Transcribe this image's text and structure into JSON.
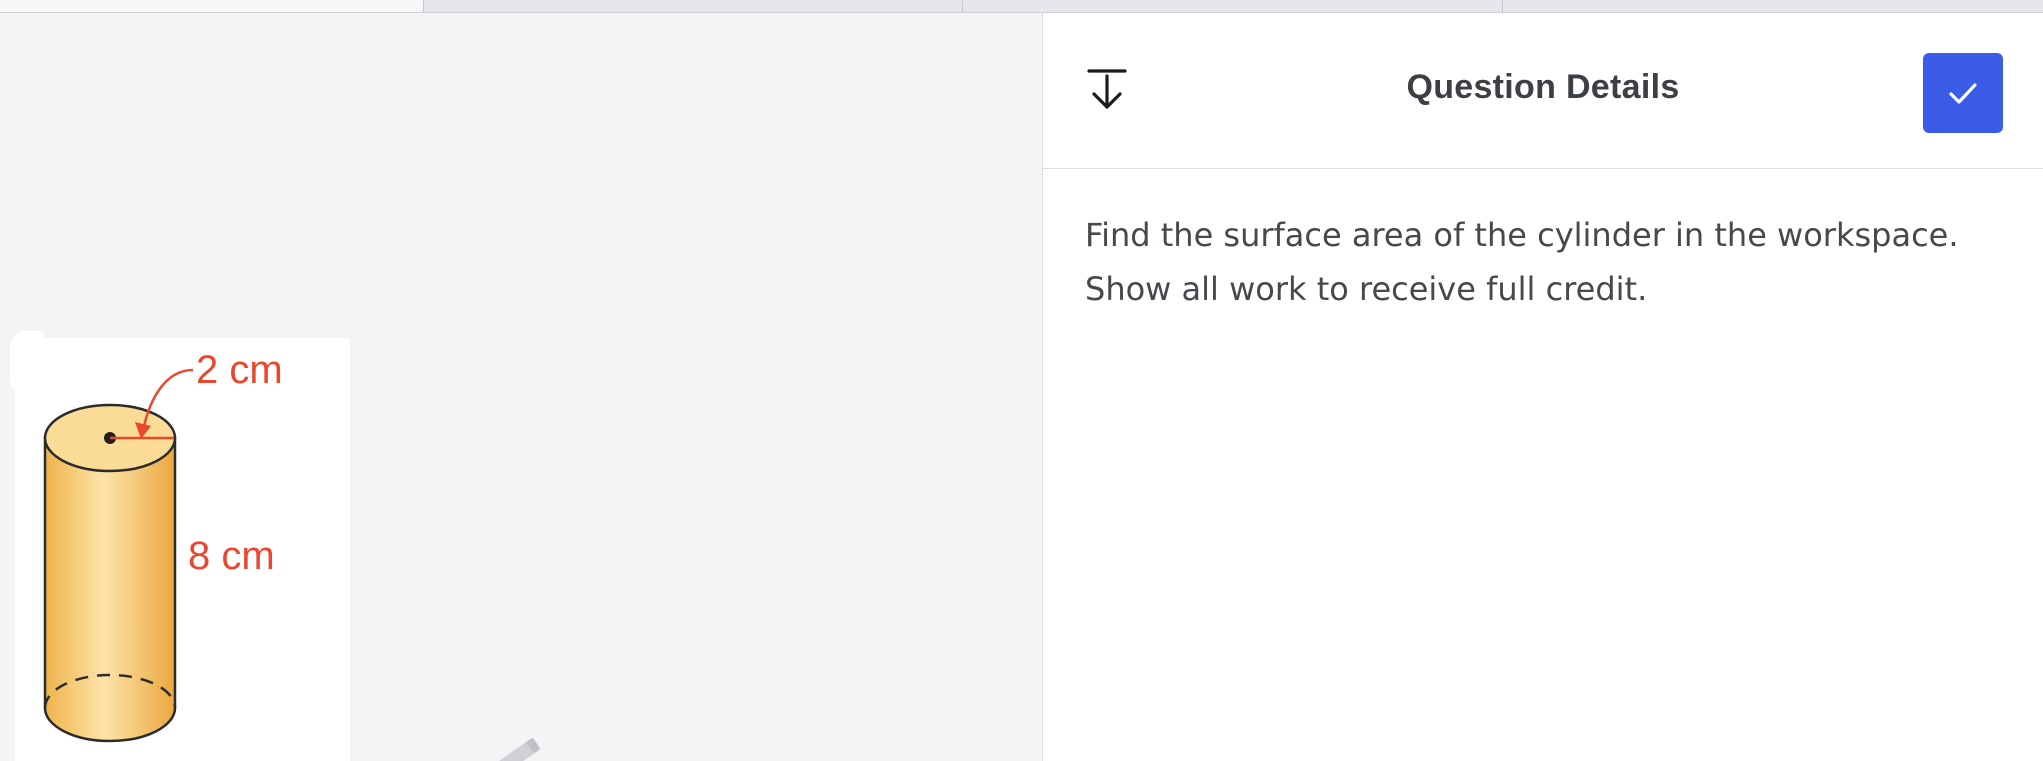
{
  "figure": {
    "radius_label": "2 cm",
    "height_label": "8 cm",
    "accent_color": "#e8482f",
    "fill_color": "#f7c86a"
  },
  "panel": {
    "title": "Question Details",
    "collapse_icon": "collapse-down-icon",
    "confirm_icon": "check-icon",
    "confirm_color": "#3a5ce6",
    "question_line1": "Find the surface area of the cylinder in the workspace.",
    "question_line2": "Show all work to receive full credit."
  }
}
